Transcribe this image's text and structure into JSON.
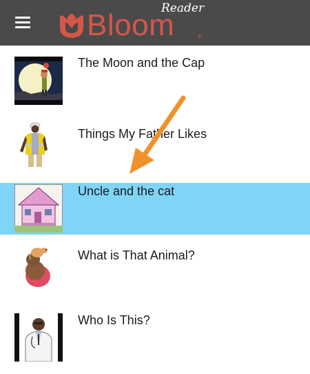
{
  "app": {
    "brand": "Bloom",
    "sub": "Reader",
    "registered_mark": "®",
    "menu_icon": "hamburger-menu-icon",
    "colors": {
      "header_bg": "#4a4a4a",
      "brand": "#d65649",
      "selected": "#7fd4f8",
      "arrow": "#f0922a"
    }
  },
  "books": [
    {
      "title": "The Moon and the Cap",
      "thumbnail": "moon-cap-cover-icon",
      "selected": false
    },
    {
      "title": "Things My Father Likes",
      "thumbnail": "worker-cover-icon",
      "selected": false
    },
    {
      "title": "Uncle and the cat",
      "thumbnail": "pink-house-cover-icon",
      "selected": true
    },
    {
      "title": "What is That Animal?",
      "thumbnail": "child-animal-cover-icon",
      "selected": false
    },
    {
      "title": "Who Is This?",
      "thumbnail": "doctor-cover-icon",
      "selected": false
    }
  ],
  "annotation": {
    "icon": "orange-arrow-icon",
    "points_to": "Uncle and the cat"
  }
}
